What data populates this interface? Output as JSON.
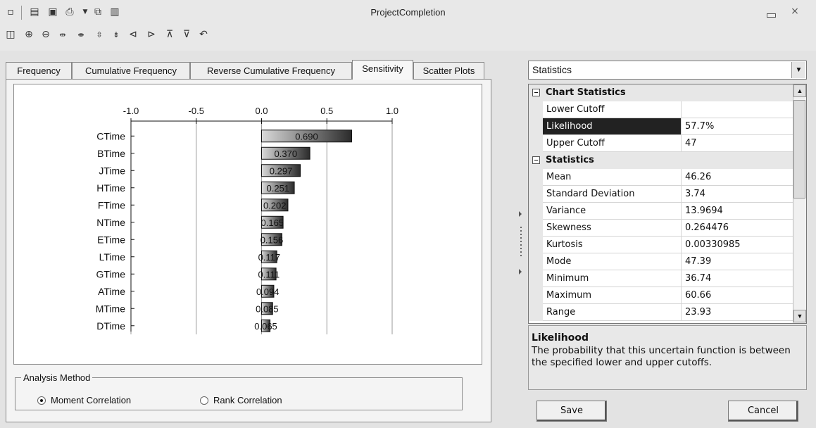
{
  "window": {
    "title": "ProjectCompletion",
    "close_glyph": "⨯"
  },
  "tabs": [
    "Frequency",
    "Cumulative Frequency",
    "Reverse Cumulative Frequency",
    "Sensitivity",
    "Scatter Plots"
  ],
  "active_tab": "Sensitivity",
  "chart_data": {
    "type": "bar",
    "orientation": "horizontal",
    "categories": [
      "CTime",
      "BTime",
      "JTime",
      "HTime",
      "FTime",
      "NTime",
      "ETime",
      "LTime",
      "GTime",
      "ATime",
      "MTime",
      "DTime"
    ],
    "values": [
      0.69,
      0.37,
      0.297,
      0.251,
      0.202,
      0.165,
      0.156,
      0.117,
      0.111,
      0.094,
      0.085,
      0.065
    ],
    "value_labels": [
      "0.690",
      "0.370",
      "0.297",
      "0.251",
      "0.202",
      "0.165",
      "0.156",
      "0.117",
      "0.111",
      "0.094",
      "0.085",
      "0.065"
    ],
    "x_ticks": [
      "-1.0",
      "-0.5",
      "0.0",
      "0.5",
      "1.0"
    ],
    "xlim": [
      -1.0,
      1.0
    ],
    "axis_position": "top",
    "grid": true,
    "bar_gradient": [
      "#d9d9d9",
      "#2b2b2b"
    ]
  },
  "analysis_method": {
    "legend": "Analysis Method",
    "options": [
      "Moment Correlation",
      "Rank Correlation"
    ],
    "selected": "Moment Correlation"
  },
  "stats_dropdown": {
    "value": "Statistics"
  },
  "property_grid": {
    "rows": [
      {
        "kind": "category",
        "name": "Chart Statistics"
      },
      {
        "kind": "prop",
        "name": "Lower Cutoff",
        "value": ""
      },
      {
        "kind": "prop",
        "name": "Likelihood",
        "value": "57.7%",
        "selected": true
      },
      {
        "kind": "prop",
        "name": "Upper Cutoff",
        "value": "47"
      },
      {
        "kind": "category",
        "name": "Statistics"
      },
      {
        "kind": "prop",
        "name": "Mean",
        "value": "46.26"
      },
      {
        "kind": "prop",
        "name": "Standard Deviation",
        "value": "3.74"
      },
      {
        "kind": "prop",
        "name": "Variance",
        "value": "13.9694"
      },
      {
        "kind": "prop",
        "name": "Skewness",
        "value": "0.264476"
      },
      {
        "kind": "prop",
        "name": "Kurtosis",
        "value": "0.00330985"
      },
      {
        "kind": "prop",
        "name": "Mode",
        "value": "47.39"
      },
      {
        "kind": "prop",
        "name": "Minimum",
        "value": "36.74"
      },
      {
        "kind": "prop",
        "name": "Maximum",
        "value": "60.66"
      },
      {
        "kind": "prop",
        "name": "Range",
        "value": "23.93"
      }
    ]
  },
  "description": {
    "title": "Likelihood",
    "text": "The probability that this uncertain function is between the specified lower and upper cutoffs."
  },
  "buttons": {
    "save": "Save",
    "cancel": "Cancel"
  },
  "toolbar_icons": [
    "restore-icon",
    "report-icon",
    "save-icon",
    "print-icon",
    "dropdown-arrow-icon",
    "copy-icon",
    "chart-icon",
    "copy-chart-icon",
    "zoom-in-icon",
    "zoom-out-icon",
    "expand-horizontal-icon",
    "shrink-horizontal-icon",
    "expand-vertical-icon",
    "shrink-vertical-icon",
    "scroll-left-icon",
    "scroll-right-icon",
    "scroll-up-icon",
    "scroll-down-icon",
    "reset-view-icon"
  ]
}
